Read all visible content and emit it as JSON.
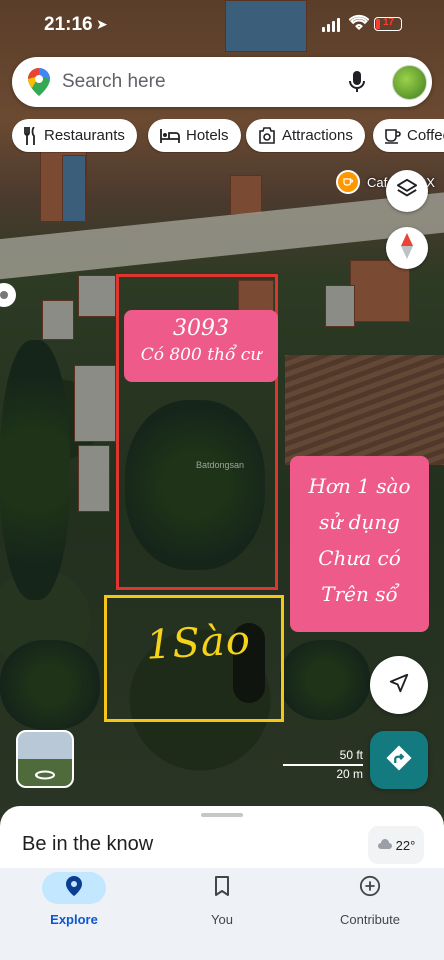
{
  "status_bar": {
    "time": "21:16",
    "battery": "17"
  },
  "search": {
    "placeholder": "Search here"
  },
  "chips": [
    {
      "label": "Restaurants",
      "icon": "fork-knife-icon"
    },
    {
      "label": "Hotels",
      "icon": "bed-icon"
    },
    {
      "label": "Attractions",
      "icon": "camera-icon"
    },
    {
      "label": "Coffee",
      "icon": "coffee-icon"
    }
  ],
  "map": {
    "poi_label": "Cafe Vựa X",
    "annotation_top": {
      "number": "3093",
      "subtitle": "Có 800 thổ cư"
    },
    "annotation_right": [
      "Hơn 1 sào",
      "sử dụng",
      "Chưa có",
      "Trên sổ"
    ],
    "handwritten": "1Sào",
    "watermark": "Batdongsan",
    "scale": {
      "feet": "50 ft",
      "meters": "20 m"
    }
  },
  "sheet": {
    "title": "Be in the know",
    "weather": "22°"
  },
  "bottom_nav": [
    {
      "label": "Explore",
      "icon": "explore-pin-icon",
      "active": true
    },
    {
      "label": "You",
      "icon": "bookmark-icon",
      "active": false
    },
    {
      "label": "Contribute",
      "icon": "plus-circle-icon",
      "active": false
    }
  ],
  "colors": {
    "accent": "#0b57d0",
    "directions": "#137a7f",
    "annotation_pink": "#ee5a8a",
    "box_red": "#e0342f",
    "box_yellow": "#f5c518"
  }
}
